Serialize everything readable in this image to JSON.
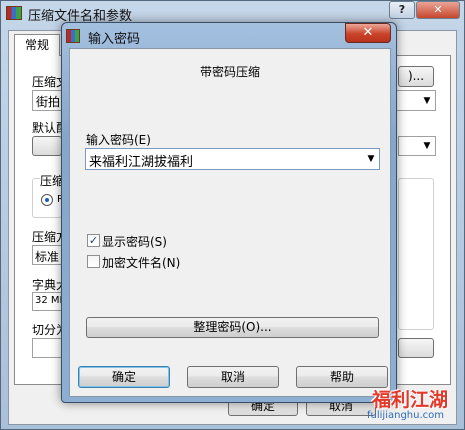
{
  "background_window": {
    "title": "压缩文件名和参数",
    "help_label": "?",
    "close_label": "✕",
    "tab_general": "常规",
    "archive_name_label": "压缩文",
    "archive_name_value": "街拍",
    "browse_label": ")...",
    "default_profile_label": "默认配",
    "format_group_label": "压缩",
    "format_option": "R",
    "method_label": "压缩方",
    "method_value": "标准",
    "dict_label": "字典大",
    "dict_value": "32 MB",
    "split_label": "切分为",
    "ok_label": "确定",
    "cancel_label": "取消",
    "arrow_glyph": "▼"
  },
  "dialog": {
    "title": "输入密码",
    "close_label": "✕",
    "header": "带密码压缩",
    "password_label": "输入密码(E)",
    "password_value": "来福利江湖拔福利",
    "dropdown_glyph": "▼",
    "show_password": {
      "label": "显示密码(S)",
      "checked": true,
      "mark": "✓"
    },
    "encrypt_filenames": {
      "label": "加密文件名(N)",
      "checked": false,
      "mark": ""
    },
    "organize_button": "整理密码(O)...",
    "ok_button": "确定",
    "cancel_button": "取消",
    "help_button": "帮助"
  },
  "watermark": {
    "logo_text": "福利江湖",
    "site_text": "fulijianghu.com"
  }
}
